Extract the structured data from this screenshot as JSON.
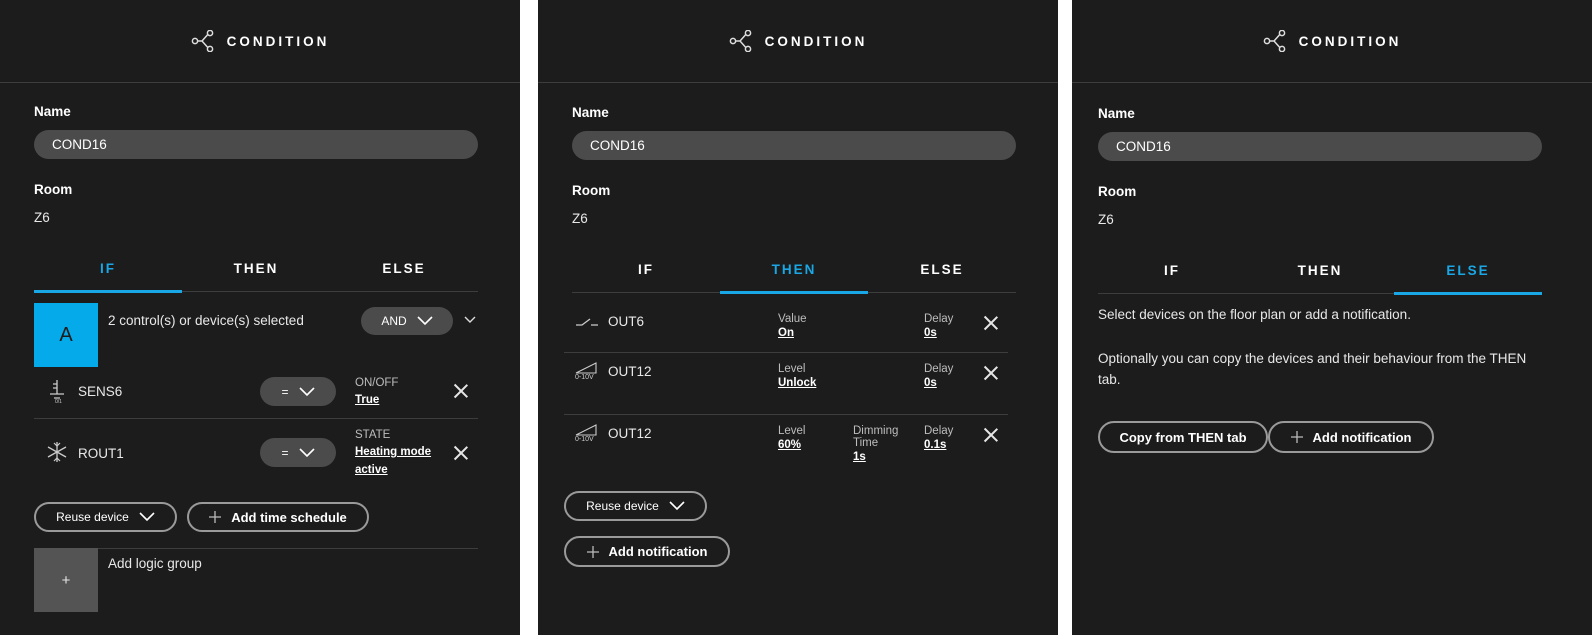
{
  "header": {
    "title": "CONDITION",
    "icon": "branch-icon"
  },
  "form": {
    "name_label": "Name",
    "name_value": "COND16",
    "room_label": "Room",
    "room_value": "Z6"
  },
  "tabs": [
    "IF",
    "THEN",
    "ELSE"
  ],
  "colors": {
    "accent": "#1aa7e6",
    "group": "#05aaea",
    "panel": "#1c1c1c",
    "field": "#4b4b4b"
  },
  "if_tab": {
    "group_letter": "A",
    "group_summary": "2 control(s) or device(s) selected",
    "logic_operator": "AND",
    "rows": [
      {
        "device": "SENS6",
        "operator": "=",
        "caption": "ON/OFF",
        "value": "True",
        "icon": "sensor-icon"
      },
      {
        "device": "ROUT1",
        "operator": "=",
        "caption": "STATE",
        "value_line1": "Heating mode",
        "value_line2": "active",
        "icon": "heating-icon"
      }
    ],
    "reuse_label": "Reuse device",
    "add_schedule_label": "Add time schedule",
    "add_group_symbol": "+",
    "add_group_label": "Add logic group"
  },
  "then_tab": {
    "rows": [
      {
        "device": "OUT6",
        "cap1": "Value",
        "val1": "On",
        "delay_cap": "Delay",
        "delay": "0s",
        "icon": "switch-icon"
      },
      {
        "device": "OUT12",
        "icon_text": "0-10V",
        "cap1": "Level",
        "val1": "Unlock",
        "delay_cap": "Delay",
        "delay": "0s",
        "icon": "dimmer-icon"
      },
      {
        "device": "OUT12",
        "icon_text": "0-10V",
        "cap1": "Level",
        "val1": "60%",
        "cap2a": "Dimming",
        "cap2b": "Time",
        "val2": "1s",
        "delay_cap": "Delay",
        "delay": "0.1s",
        "icon": "dimmer-icon"
      }
    ],
    "reuse_label": "Reuse device",
    "add_notification_label": "Add notification"
  },
  "else_tab": {
    "text1": "Select devices on the floor plan or add a notification.",
    "text2": "Optionally you can copy the devices and their behaviour from the THEN tab.",
    "copy_label": "Copy from THEN tab",
    "add_notification_label": "Add notification"
  }
}
